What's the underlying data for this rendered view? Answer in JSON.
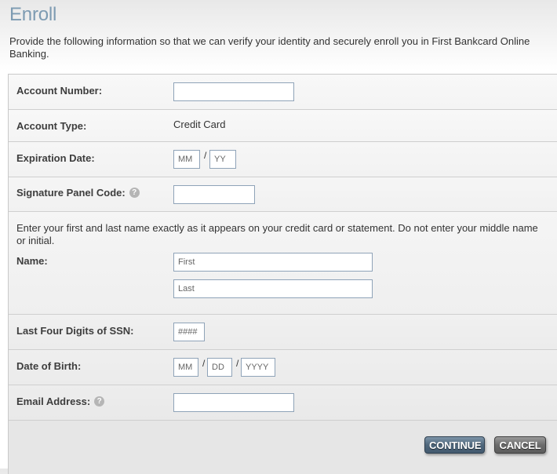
{
  "page": {
    "title": "Enroll",
    "intro": "Provide the following information so that we can verify your identity and securely enroll you in First Bankcard Online Banking."
  },
  "form": {
    "account_number": {
      "label": "Account Number:",
      "value": "",
      "placeholder": ""
    },
    "account_type": {
      "label": "Account Type:",
      "value": "Credit Card"
    },
    "expiration_date": {
      "label": "Expiration Date:",
      "month_placeholder": "MM",
      "year_placeholder": "YY",
      "separator": "/"
    },
    "signature_panel_code": {
      "label": "Signature Panel Code:",
      "help_icon": "question-circle-icon",
      "value": ""
    },
    "name": {
      "instructions": "Enter your first and last name exactly as it appears on your credit card or statement. Do not enter your middle name or initial.",
      "label": "Name:",
      "first_placeholder": "First",
      "last_placeholder": "Last"
    },
    "ssn_last_four": {
      "label": "Last Four Digits of SSN:",
      "placeholder": "####"
    },
    "date_of_birth": {
      "label": "Date of Birth:",
      "month_placeholder": "MM",
      "day_placeholder": "DD",
      "year_placeholder": "YYYY",
      "separator": "/"
    },
    "email": {
      "label": "Email Address:",
      "help_icon": "question-circle-icon",
      "value": ""
    },
    "help_glyph": "?"
  },
  "actions": {
    "continue_label": "CONTINUE",
    "cancel_label": "CANCEL"
  },
  "colors": {
    "title": "#7d9bb2",
    "input_border": "#8fa3b8",
    "continue_button": "#4f677c",
    "cancel_button": "#6c6c6c"
  }
}
